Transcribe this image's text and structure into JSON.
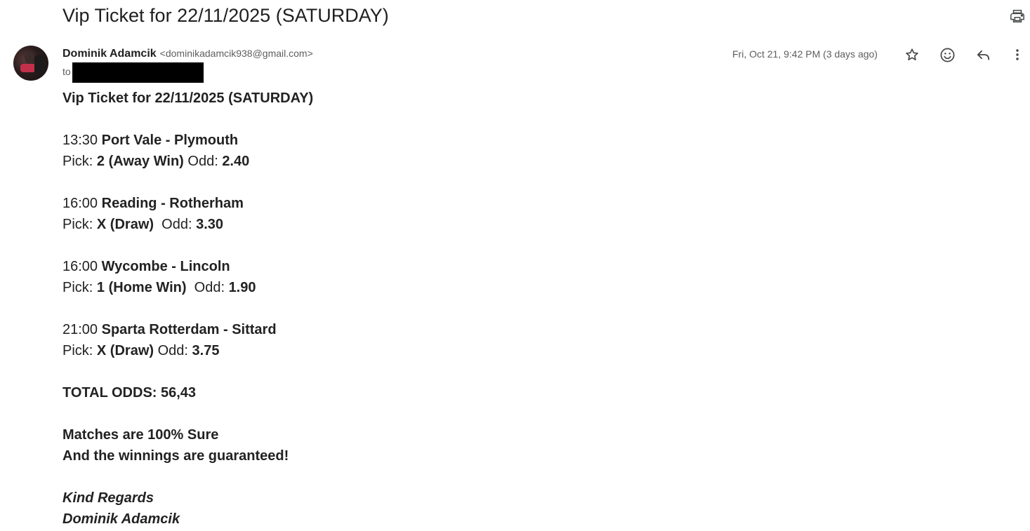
{
  "email": {
    "subject": "Vip Ticket for 22/11/2025 (SATURDAY)",
    "sender_name": "Dominik Adamcik",
    "sender_email": "<dominikadamcik938@gmail.com>",
    "to_label": "to",
    "date": "Fri, Oct 21, 9:42 PM (3 days ago)"
  },
  "icons": {
    "print": "print-icon",
    "star": "star-icon",
    "emoji": "emoji-icon",
    "reply": "reply-icon",
    "more": "more-vert-icon"
  },
  "body": {
    "title": "Vip Ticket for 22/11/2025 (SATURDAY)",
    "pick_label": "Pick:",
    "odd_label": "Odd:",
    "matches": [
      {
        "time": "13:30",
        "teams": "Port Vale - Plymouth",
        "pick": "2 (Away Win)",
        "odd": "2.40"
      },
      {
        "time": "16:00",
        "teams": "Reading - Rotherham",
        "pick": "X (Draw)",
        "odd": "3.30"
      },
      {
        "time": "16:00",
        "teams": "Wycombe - Lincoln",
        "pick": "1 (Home Win)",
        "odd": "1.90"
      },
      {
        "time": "21:00",
        "teams": "Sparta Rotterdam - Sittard",
        "pick": "X (Draw)",
        "odd": "3.75"
      }
    ],
    "total_odds": "TOTAL ODDS: 56,43",
    "claim_1": "Matches are 100% Sure",
    "claim_2": "And the winnings are guaranteed!",
    "sign_off": "Kind Regards",
    "signature": "Dominik Adamcik"
  }
}
